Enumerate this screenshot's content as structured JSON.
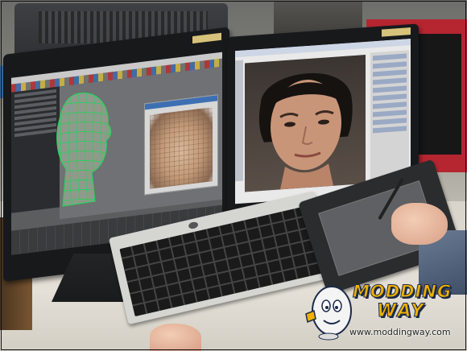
{
  "watermark": {
    "logo_line1": "MODDING",
    "logo_line2": "WAY",
    "url": "www.moddingway.com"
  },
  "colors": {
    "wireframe": "#2bd05a",
    "logo_fill": "#f0b100",
    "logo_outline": "#1b2a4a"
  }
}
